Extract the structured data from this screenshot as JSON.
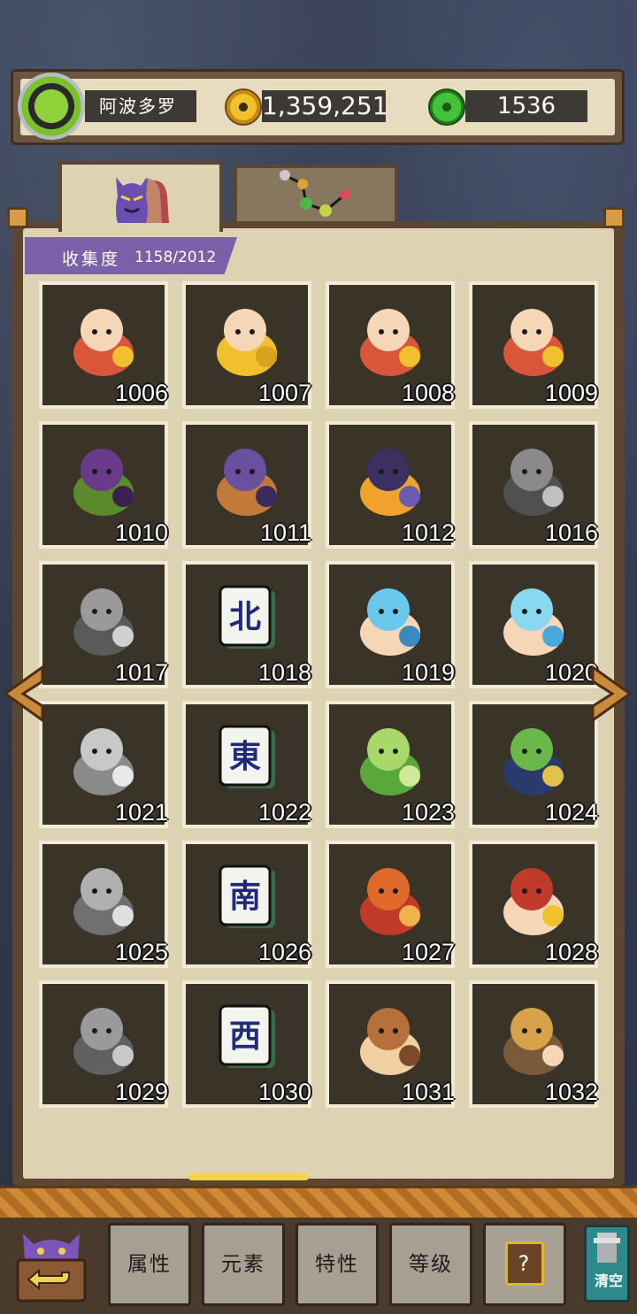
{
  "header": {
    "player_name": "阿波多罗",
    "coins": "1,359,251",
    "jade": "1536"
  },
  "tabs": [
    {
      "name": "monsters",
      "icon": "purple-monster-icon",
      "active": true
    },
    {
      "name": "elements",
      "icon": "element-chain-icon",
      "active": false
    }
  ],
  "collection": {
    "label": "收集度",
    "value": "1158/2012"
  },
  "items": [
    {
      "id": "1006",
      "icon": "fortune-girl-icon"
    },
    {
      "id": "1007",
      "icon": "gold-ingot-baby-icon"
    },
    {
      "id": "1008",
      "icon": "baby-with-ingot-icon"
    },
    {
      "id": "1009",
      "icon": "fortune-girl-icon"
    },
    {
      "id": "1010",
      "icon": "eggplant-icon"
    },
    {
      "id": "1011",
      "icon": "purple-bird-icon"
    },
    {
      "id": "1012",
      "icon": "dark-phoenix-icon"
    },
    {
      "id": "1016",
      "icon": "stone-lantern-icon"
    },
    {
      "id": "1017",
      "icon": "stone-warrior-icon"
    },
    {
      "id": "1018",
      "icon": "mahjong-north-icon",
      "glyph": "北"
    },
    {
      "id": "1019",
      "icon": "blue-fish-icon"
    },
    {
      "id": "1020",
      "icon": "water-spirit-icon"
    },
    {
      "id": "1021",
      "icon": "stone-phoenix-icon"
    },
    {
      "id": "1022",
      "icon": "mahjong-east-icon",
      "glyph": "東"
    },
    {
      "id": "1023",
      "icon": "green-sprout-chick-icon"
    },
    {
      "id": "1024",
      "icon": "flute-bird-icon"
    },
    {
      "id": "1025",
      "icon": "stone-guardian-icon"
    },
    {
      "id": "1026",
      "icon": "mahjong-south-icon",
      "glyph": "南"
    },
    {
      "id": "1027",
      "icon": "fire-monkey-icon"
    },
    {
      "id": "1028",
      "icon": "red-hat-elder-icon"
    },
    {
      "id": "1029",
      "icon": "stone-sage-icon"
    },
    {
      "id": "1030",
      "icon": "mahjong-west-icon",
      "glyph": "西"
    },
    {
      "id": "1031",
      "icon": "brown-owl-icon"
    },
    {
      "id": "1032",
      "icon": "straw-hat-hermit-icon"
    }
  ],
  "buttons": {
    "attributes": "属性",
    "elements": "元素",
    "traits": "特性",
    "level": "等级",
    "help": "?",
    "clear": "清空"
  },
  "colors": {
    "panel_bg": "#ddd3b2",
    "cell_bg": "#3a3328",
    "progress_bar": "#7b5fa8",
    "accent_gold": "#f2d24a"
  }
}
